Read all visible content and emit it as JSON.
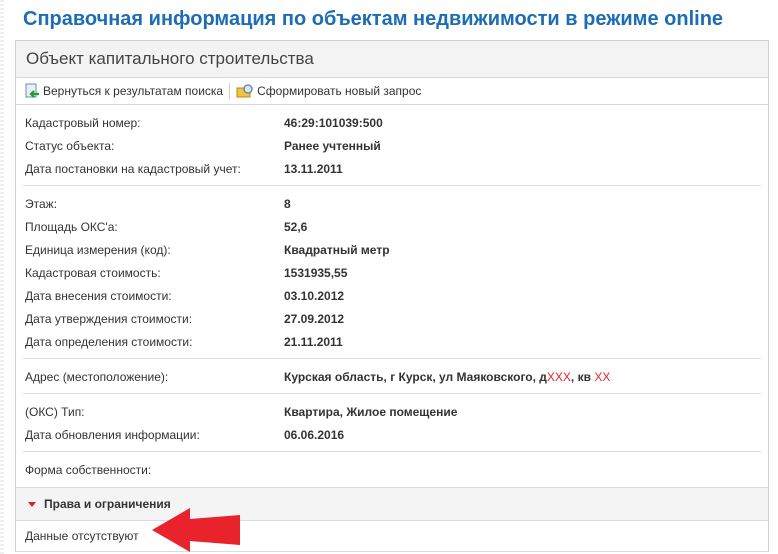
{
  "page_title": "Справочная информация по объектам недвижимости в режиме online",
  "panel_title": "Объект капитального строительства",
  "toolbar": {
    "back_label": "Вернуться к результатам поиска",
    "new_query_label": "Сформировать новый запрос"
  },
  "groups": [
    [
      {
        "label": "Кадастровый номер:",
        "value": "46:29:101039:500"
      },
      {
        "label": "Статус объекта:",
        "value": "Ранее учтенный"
      },
      {
        "label": "Дата постановки на кадастровый учет:",
        "value": "13.11.2011"
      }
    ],
    [
      {
        "label": "Этаж:",
        "value": "8"
      },
      {
        "label": "Площадь ОКС'а:",
        "value": "52,6"
      },
      {
        "label": "Единица измерения (код):",
        "value": "Квадратный метр"
      },
      {
        "label": "Кадастровая стоимость:",
        "value": "1531935,55"
      },
      {
        "label": "Дата внесения стоимости:",
        "value": "03.10.2012"
      },
      {
        "label": "Дата утверждения стоимости:",
        "value": "27.09.2012"
      },
      {
        "label": "Дата определения стоимости:",
        "value": "21.11.2011"
      }
    ]
  ],
  "address": {
    "label": "Адрес (местоположение):",
    "prefix": "Курская область, г Курск, ул Маяковского, д",
    "house": "XXX",
    "mid": ", кв ",
    "flat": "XX"
  },
  "type_group": [
    {
      "label": "(ОКС) Тип:",
      "value": "Квартира, Жилое помещение"
    },
    {
      "label": "Дата обновления информации:",
      "value": "06.06.2016"
    }
  ],
  "ownership": {
    "label": "Форма собственности:",
    "value": ""
  },
  "rights_section": {
    "title": "Права и ограничения",
    "content": "Данные отсутствуют"
  },
  "colors": {
    "title": "#1c6db5",
    "arrow": "#e8232b"
  }
}
